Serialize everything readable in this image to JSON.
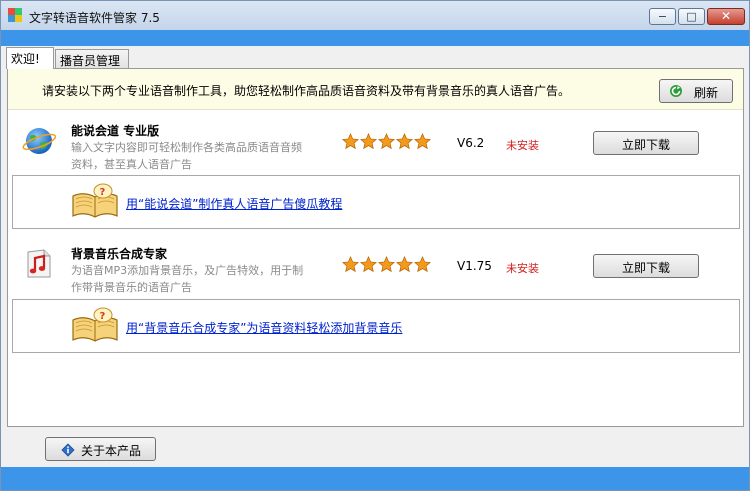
{
  "window": {
    "title": "文字转语音软件管家 7.5",
    "controls": {
      "minimize": "−",
      "maximize": "□",
      "close": "✕"
    }
  },
  "tabs": [
    {
      "label": "欢迎!",
      "active": true
    },
    {
      "label": "播音员管理",
      "active": false
    }
  ],
  "notice": {
    "text": "请安装以下两个专业语音制作工具，助您轻松制作高品质语音资料及带有背景音乐的真人语音广告。",
    "refresh_label": "刷新",
    "refresh_icon": "refresh-icon"
  },
  "products": [
    {
      "name": "能说会道 专业版",
      "desc_line1": "输入文字内容即可轻松制作各类高品质语音音频",
      "desc_line2": "资料，甚至真人语音广告",
      "icon": "globe-icon",
      "rating": 5,
      "version": "V6.2",
      "status": "未安装",
      "download_label": "立即下载",
      "tutorial_link": "用“能说会道”制作真人语音广告傻瓜教程"
    },
    {
      "name": "背景音乐合成专家",
      "desc_line1": "为语音MP3添加背景音乐，及广告特效，用于制",
      "desc_line2": "作带背景音乐的语音广告",
      "icon": "music-note-icon",
      "rating": 5,
      "version": "V1.75",
      "status": "未安装",
      "download_label": "立即下载",
      "tutorial_link": "用“背景音乐合成专家”为语音资料轻松添加背景音乐"
    }
  ],
  "footer": {
    "about_label": "关于本产品",
    "about_icon": "info-icon"
  },
  "colors": {
    "accent_bar": "#3c95e8",
    "status_red": "#d42020",
    "link_blue": "#0022cc",
    "notice_bg": "#fdfde6"
  }
}
